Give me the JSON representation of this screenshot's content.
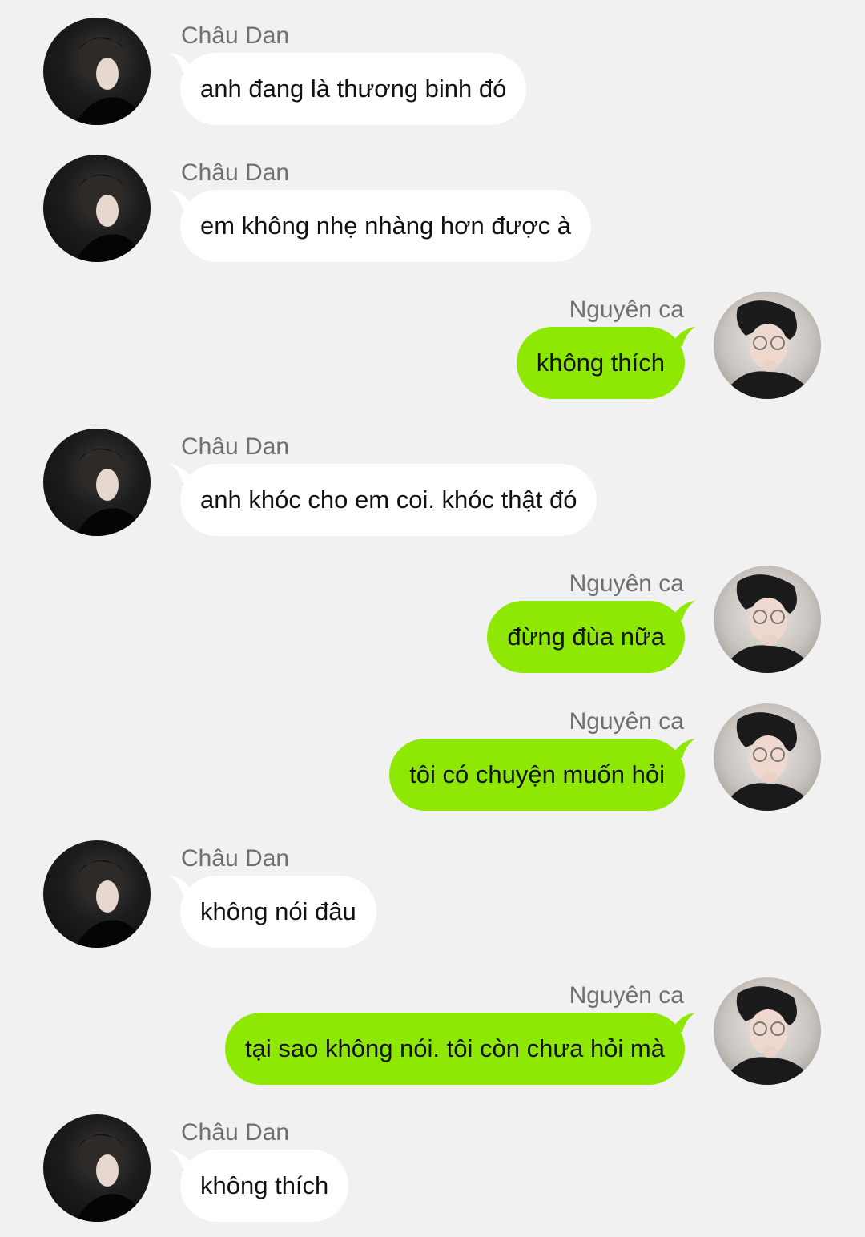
{
  "chat": {
    "colors": {
      "background": "#f1f1f1",
      "incoming_bubble": "#ffffff",
      "outgoing_bubble": "#8ee804",
      "name_text": "#6f6f6f"
    },
    "messages": [
      {
        "side": "left",
        "sender": "Châu Dan",
        "text": "anh đang là thương binh đó",
        "avatar": "chau-dan-avatar"
      },
      {
        "side": "left",
        "sender": "Châu Dan",
        "text": "em không nhẹ nhàng hơn được à",
        "avatar": "chau-dan-avatar"
      },
      {
        "side": "right",
        "sender": "Nguyên ca",
        "text": "không thích",
        "avatar": "nguyen-ca-avatar"
      },
      {
        "side": "left",
        "sender": "Châu Dan",
        "text": "anh khóc cho em coi. khóc thật đó",
        "avatar": "chau-dan-avatar"
      },
      {
        "side": "right",
        "sender": "Nguyên ca",
        "text": "đừng đùa nữa",
        "avatar": "nguyen-ca-avatar"
      },
      {
        "side": "right",
        "sender": "Nguyên ca",
        "text": "tôi có chuyện muốn hỏi",
        "avatar": "nguyen-ca-avatar"
      },
      {
        "side": "left",
        "sender": "Châu Dan",
        "text": "không nói đâu",
        "avatar": "chau-dan-avatar"
      },
      {
        "side": "right",
        "sender": "Nguyên ca",
        "text": "tại sao không nói. tôi còn chưa hỏi mà",
        "avatar": "nguyen-ca-avatar"
      },
      {
        "side": "left",
        "sender": "Châu Dan",
        "text": "không thích",
        "avatar": "chau-dan-avatar"
      }
    ]
  }
}
